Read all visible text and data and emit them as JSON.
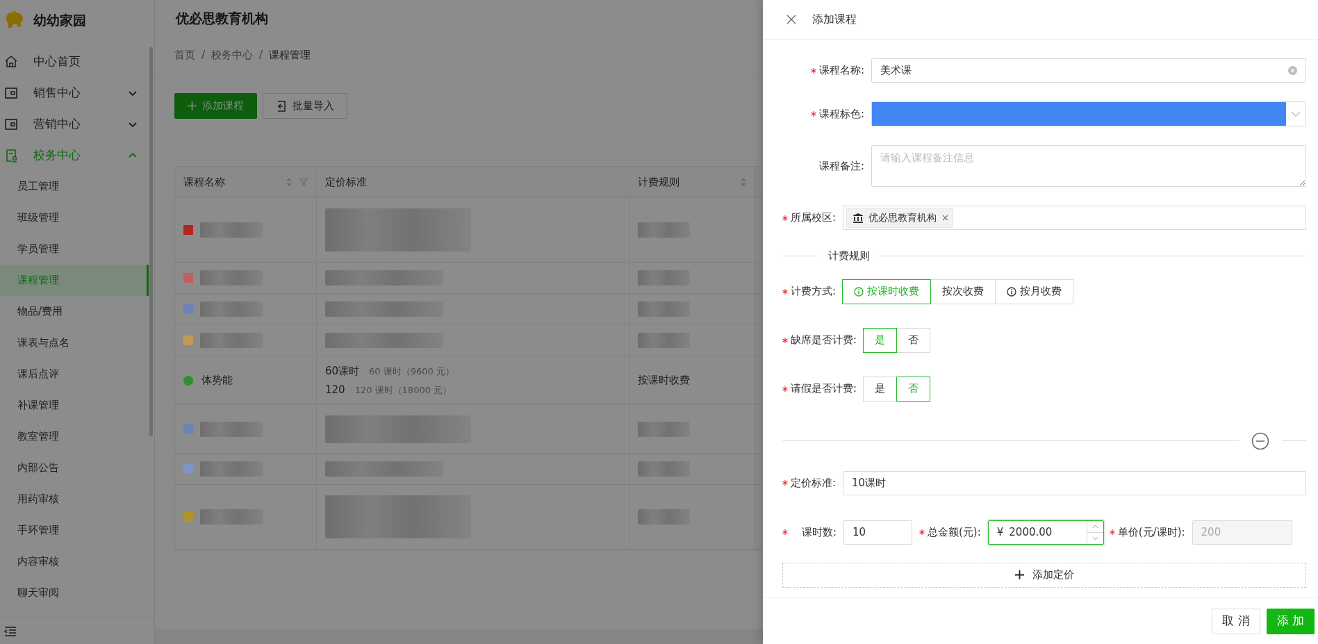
{
  "sidebar": {
    "brand": "幼幼家园",
    "items": [
      {
        "label": "中心首页",
        "selected": false
      },
      {
        "label": "销售中心",
        "selected": false,
        "expanded": false
      },
      {
        "label": "营销中心",
        "selected": false,
        "expanded": false
      },
      {
        "label": "校务中心",
        "selected": true,
        "expanded": true,
        "children": [
          {
            "label": "员工管理",
            "selected": false
          },
          {
            "label": "班级管理",
            "selected": false
          },
          {
            "label": "学员管理",
            "selected": false
          },
          {
            "label": "课程管理",
            "selected": true
          },
          {
            "label": "物品/费用",
            "selected": false
          },
          {
            "label": "课表与点名",
            "selected": false
          },
          {
            "label": "课后点评",
            "selected": false
          },
          {
            "label": "补课管理",
            "selected": false
          },
          {
            "label": "教室管理",
            "selected": false
          },
          {
            "label": "内部公告",
            "selected": false
          },
          {
            "label": "用药审核",
            "selected": false
          },
          {
            "label": "手环管理",
            "selected": false
          },
          {
            "label": "内容审核",
            "selected": false
          },
          {
            "label": "聊天审阅",
            "selected": false
          }
        ]
      }
    ]
  },
  "header": {
    "title": "优必思教育机构"
  },
  "breadcrumb": [
    {
      "kind": "link",
      "label": "首页"
    },
    {
      "kind": "separator",
      "label": "/"
    },
    {
      "kind": "link",
      "label": "校务中心"
    },
    {
      "kind": "separator",
      "label": "/"
    },
    {
      "kind": "current",
      "label": "课程管理"
    }
  ],
  "toolbar": [
    {
      "label": "添加课程",
      "kind": "primary"
    },
    {
      "label": "批量导入",
      "kind": "default"
    }
  ],
  "table": {
    "columns": [
      {
        "label": "课程名称",
        "sortable": true,
        "filterable": true
      },
      {
        "label": "定价标准",
        "sortable": false,
        "filterable": false
      },
      {
        "label": "计费规则",
        "sortable": true,
        "filterable": false
      }
    ],
    "rows": [
      {
        "kind": "tall",
        "color": "#b3261f"
      },
      {
        "kind": "short",
        "color": "#c06060"
      },
      {
        "kind": "short",
        "color": "#6a83b8"
      },
      {
        "kind": "short",
        "color": "#c09a5a"
      },
      {
        "kind": "course",
        "color": "#2d8f2d",
        "name": "体势能",
        "prices": [
          {
            "name": "60课时",
            "detail": "60 课时（9600 元）"
          },
          {
            "name": "120",
            "detail": "120 课时（18000 元）"
          }
        ],
        "billing": "按课时收费"
      },
      {
        "kind": "medium",
        "color": "#6a83b8"
      },
      {
        "kind": "short",
        "color": "#7d95c4"
      },
      {
        "kind": "tall",
        "color": "#b0942a"
      }
    ]
  },
  "drawer": {
    "title": "添加课程",
    "fields": [
      {
        "kind": "text",
        "label": "课程名称:",
        "required": true,
        "value": "美术课"
      },
      {
        "kind": "color",
        "label": "课程标色:",
        "required": true,
        "color": "#4286f5"
      },
      {
        "kind": "textarea",
        "label": "课程备注:",
        "required": false,
        "placeholder": "请输入课程备注信息"
      },
      {
        "kind": "tags",
        "label": "所属校区:",
        "required": true,
        "tags": [
          "优必思教育机构"
        ]
      }
    ],
    "section_title": "计费规则",
    "choices": [
      {
        "label": "计费方式:",
        "required": true,
        "options": [
          {
            "label": "按课时收费",
            "info": true,
            "selected": true
          },
          {
            "label": "按次收费",
            "info": false,
            "selected": false
          },
          {
            "label": "按月收费",
            "info": true,
            "selected": false
          }
        ]
      },
      {
        "label": "缺席是否计费:",
        "required": true,
        "options": [
          {
            "label": "是",
            "info": false,
            "selected": true
          },
          {
            "label": "否",
            "info": false,
            "selected": false
          }
        ]
      },
      {
        "label": "请假是否计费:",
        "required": true,
        "options": [
          {
            "label": "是",
            "info": false,
            "selected": false
          },
          {
            "label": "否",
            "info": false,
            "selected": true
          }
        ]
      }
    ],
    "pricing": {
      "standard_label": "定价标准:",
      "standard_value": "10课时",
      "hours_label": "课时数:",
      "hours_value": "10",
      "total_label": "总金额(元):",
      "currency": "¥",
      "total_value": "2000.00",
      "unit_label": "单价(元/课时):",
      "unit_value": "200"
    },
    "add_price": "添加定价",
    "buttons": [
      {
        "label": "取 消",
        "kind": "default"
      },
      {
        "label": "添 加",
        "kind": "primary"
      }
    ]
  }
}
